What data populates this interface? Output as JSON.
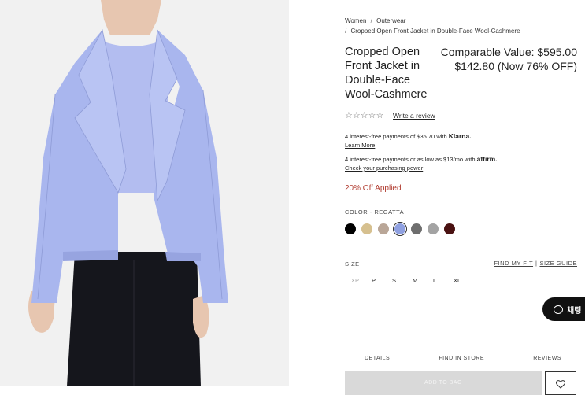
{
  "breadcrumb": {
    "items": [
      "Women",
      "Outerwear",
      "Cropped Open Front Jacket in Double-Face Wool-Cashmere"
    ],
    "separator": "/"
  },
  "product": {
    "title": "Cropped Open Front Jacket in Double-Face Wool-Cashmere",
    "comparable_value": "Comparable Value: $595.00",
    "sale_price": "$142.80 (Now 76% OFF)",
    "rating_stars": "☆☆☆☆☆",
    "write_review": "Write a review",
    "discount_note": "20% Off Applied"
  },
  "payments": {
    "klarna_text": "4 interest-free payments of $35.70 with",
    "klarna_brand": "Klarna.",
    "klarna_link": "Learn More",
    "affirm_text": "4 interest-free payments or as low as $13/mo with",
    "affirm_brand": "affirm.",
    "affirm_link": "Check your purchasing power"
  },
  "color": {
    "label": "COLOR -",
    "selected": "REGATTA",
    "swatches": [
      "#000000",
      "#d6c08f",
      "#b9a697",
      "#8fa0e0",
      "#6e6e6e",
      "#a3a3a3",
      "#4a1212"
    ],
    "selected_index": 3
  },
  "size": {
    "label": "SIZE",
    "find_my_fit": "FIND MY FIT",
    "size_guide": "SIZE GUIDE",
    "options": [
      "XP",
      "P",
      "S",
      "M",
      "L",
      "XL"
    ],
    "unavailable": [
      "XP"
    ]
  },
  "chat": {
    "label": "채팅"
  },
  "tabs": [
    "DETAILS",
    "FIND IN STORE",
    "REVIEWS"
  ],
  "add_to_bag": "ADD TO BAG",
  "colors": {
    "accent_sale": "#b03a2e",
    "jacket": "#a9b6ee",
    "background_image": "#f1f1f1"
  }
}
